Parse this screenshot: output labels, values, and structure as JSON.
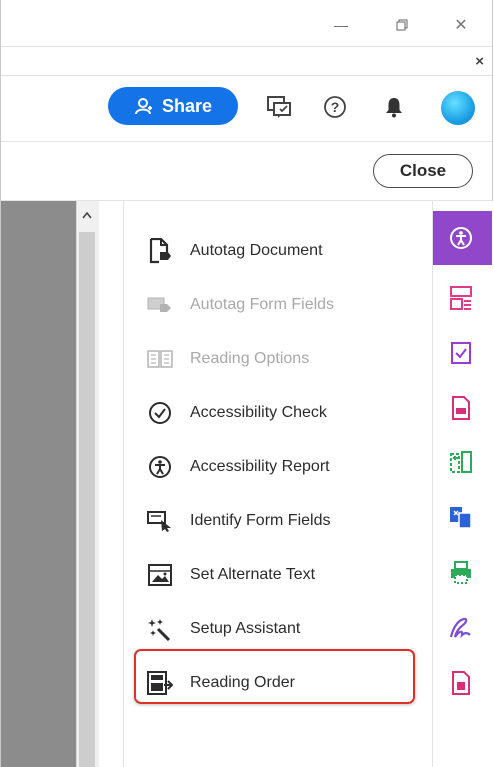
{
  "window": {
    "minimize_glyph": "—",
    "restore_icon": "restore-icon",
    "close_glyph": "✕",
    "doc_close_glyph": "×"
  },
  "toolbar": {
    "share_label": "Share",
    "share_icon": "share-person-icon",
    "comment_icon": "comment-icon",
    "help_glyph": "?",
    "bell_icon": "bell-icon",
    "avatar_icon": "avatar",
    "accent": "#1473e6"
  },
  "close_button": {
    "label": "Close"
  },
  "tools": [
    {
      "label": "Autotag Document",
      "icon": "autotag-document-icon",
      "enabled": true
    },
    {
      "label": "Autotag Form Fields",
      "icon": "autotag-form-fields-icon",
      "enabled": false
    },
    {
      "label": "Reading Options",
      "icon": "reading-options-icon",
      "enabled": false
    },
    {
      "label": "Accessibility Check",
      "icon": "accessibility-check-icon",
      "enabled": true
    },
    {
      "label": "Accessibility Report",
      "icon": "accessibility-report-icon",
      "enabled": true
    },
    {
      "label": "Identify Form Fields",
      "icon": "identify-form-fields-icon",
      "enabled": true
    },
    {
      "label": "Set Alternate Text",
      "icon": "set-alternate-text-icon",
      "enabled": true
    },
    {
      "label": "Setup Assistant",
      "icon": "setup-assistant-icon",
      "enabled": true
    },
    {
      "label": "Reading Order",
      "icon": "reading-order-icon",
      "enabled": true,
      "highlighted": true
    }
  ],
  "right_rail": {
    "active_color": "#9147c9",
    "items": [
      {
        "icon": "accessibility-tool-icon",
        "color": "#ffffff",
        "active": true
      },
      {
        "icon": "organize-pages-icon",
        "color": "#e23a8b"
      },
      {
        "icon": "prepare-form-icon",
        "color": "#9c3ad6"
      },
      {
        "icon": "export-pdf-icon",
        "color": "#d7307a"
      },
      {
        "icon": "compare-files-icon",
        "color": "#2dab58"
      },
      {
        "icon": "combine-files-icon",
        "color": "#2a63d6"
      },
      {
        "icon": "print-production-icon",
        "color": "#2dab58"
      },
      {
        "icon": "fill-sign-icon",
        "color": "#7b4fd6"
      },
      {
        "icon": "rich-media-icon",
        "color": "#d7307a"
      }
    ]
  },
  "highlight_color": "#e0302a"
}
